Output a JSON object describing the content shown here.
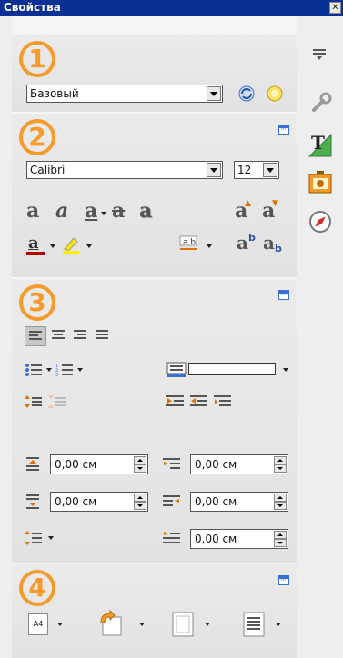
{
  "window": {
    "title": "Свойства",
    "close_label": "✕"
  },
  "sections": {
    "styles": {
      "badge": "1",
      "style_value": "Базовый"
    },
    "character": {
      "badge": "2",
      "font_value": "Calibri",
      "size_value": "12",
      "buttons": [
        "bold",
        "italic",
        "underline",
        "strikethrough",
        "shadow",
        "grow-font",
        "shrink-font",
        "font-color",
        "highlight",
        "spacing",
        "superscript",
        "subscript"
      ]
    },
    "paragraph": {
      "badge": "3",
      "indent_before": "0,00 см",
      "spacing_above": "0,00 см",
      "spacing_below": "0,00 см",
      "indent_after": "0,00 см",
      "first_line": "0,00 см"
    },
    "page": {
      "badge": "4",
      "size_label": "A4"
    }
  },
  "sidebar": {
    "items": [
      "menu",
      "properties",
      "styles",
      "gallery",
      "navigator"
    ]
  },
  "colors": {
    "badge": "#f59a2b",
    "titlebar": "#0a2f95",
    "font_color": "#b00000",
    "highlight": "#ffee00"
  }
}
